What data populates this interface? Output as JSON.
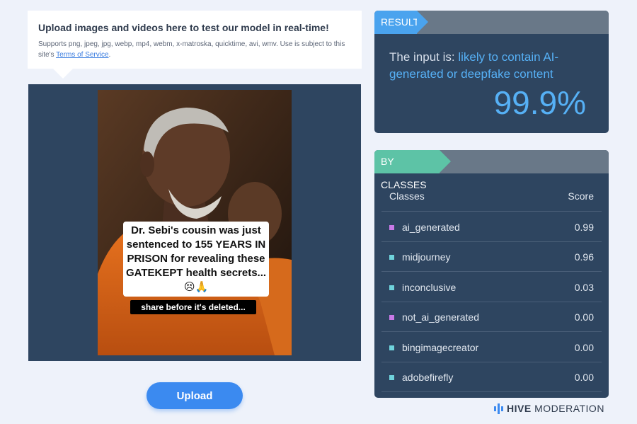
{
  "upload_info": {
    "title": "Upload images and videos here to test our model in real-time!",
    "supports_text": "Supports png, jpeg, jpg, webp, mp4, webm, x-matroska, quicktime, avi, wmv. Use is subject to this site's ",
    "tos_link": "Terms of Service",
    "tos_suffix": "."
  },
  "media": {
    "caption": "Dr. Sebi's cousin was just sentenced to 155 YEARS IN PRISON for revealing these GATEKEPT health secrets... 😣🙏",
    "tag": "share before it's deleted..."
  },
  "upload_button": {
    "label": "Upload"
  },
  "result": {
    "header": "RESULT",
    "prefix": "The input is: ",
    "verdict": "likely to contain AI-generated or deepfake content",
    "score": "99.9%"
  },
  "classes": {
    "header": "BY CLASSES",
    "col_class": "Classes",
    "col_score": "Score",
    "rows": [
      {
        "name": "ai_generated",
        "score": "0.99",
        "color": "#c97ae8"
      },
      {
        "name": "midjourney",
        "score": "0.96",
        "color": "#6fd3dc"
      },
      {
        "name": "inconclusive",
        "score": "0.03",
        "color": "#6fd3dc"
      },
      {
        "name": "not_ai_generated",
        "score": "0.00",
        "color": "#c97ae8"
      },
      {
        "name": "bingimagecreator",
        "score": "0.00",
        "color": "#6fd3dc"
      },
      {
        "name": "adobefirefly",
        "score": "0.00",
        "color": "#6fd3dc"
      }
    ]
  },
  "brand": {
    "name_bold": "HIVE",
    "name_rest": " MODERATION",
    "logo_color": "#3b8af0"
  }
}
